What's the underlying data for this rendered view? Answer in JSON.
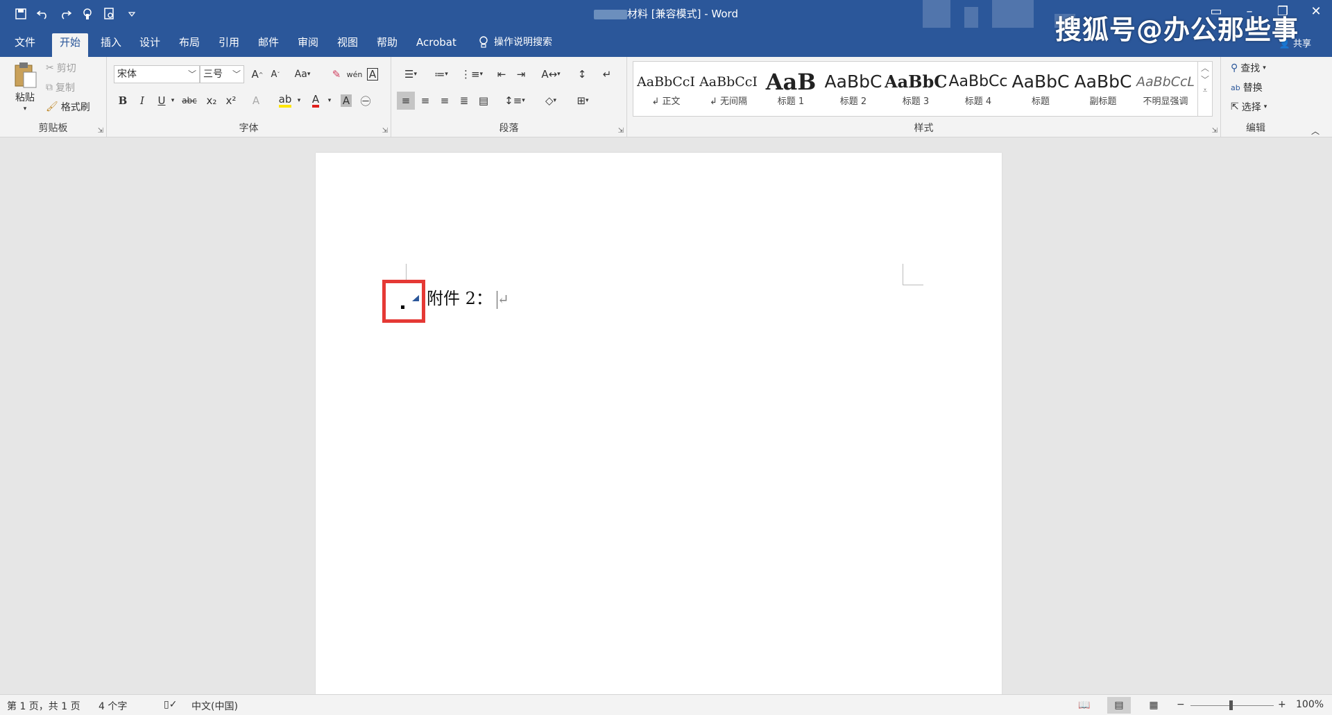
{
  "window": {
    "title_suffix": "材料 [兼容模式] - Word",
    "watermark": "搜狐号@办公那些事",
    "share": "共享"
  },
  "tabs": [
    "文件",
    "开始",
    "插入",
    "设计",
    "布局",
    "引用",
    "邮件",
    "审阅",
    "视图",
    "帮助",
    "Acrobat"
  ],
  "active_tab": "开始",
  "tell_me": "操作说明搜索",
  "clipboard": {
    "paste": "粘贴",
    "cut": "剪切",
    "copy": "复制",
    "format_painter": "格式刷",
    "label": "剪贴板"
  },
  "font": {
    "name": "宋体",
    "size": "三号",
    "label": "字体",
    "case_btn": "Aa",
    "bold": "B",
    "italic": "I",
    "underline": "U",
    "strike": "abc",
    "subscript": "x₂",
    "superscript": "x²"
  },
  "paragraph": {
    "label": "段落"
  },
  "styles": {
    "label": "样式",
    "items": [
      {
        "sample": "AaBbCcI",
        "name": "正文"
      },
      {
        "sample": "AaBbCcI",
        "name": "无间隔"
      },
      {
        "sample": "AaB",
        "name": "标题 1"
      },
      {
        "sample": "AaBbC",
        "name": "标题 2"
      },
      {
        "sample": "AaBbC",
        "name": "标题 3"
      },
      {
        "sample": "AaBbCc",
        "name": "标题 4"
      },
      {
        "sample": "AaBbC",
        "name": "标题"
      },
      {
        "sample": "AaBbC",
        "name": "副标题"
      },
      {
        "sample": "AaBbCcL",
        "name": "不明显强调"
      }
    ]
  },
  "editing": {
    "find": "查找",
    "replace": "替换",
    "select": "选择",
    "label": "编辑"
  },
  "document": {
    "text": "附件 2："
  },
  "status": {
    "page": "第 1 页，共 1 页",
    "words": "4 个字",
    "language": "中文(中国)",
    "zoom": "100%"
  }
}
